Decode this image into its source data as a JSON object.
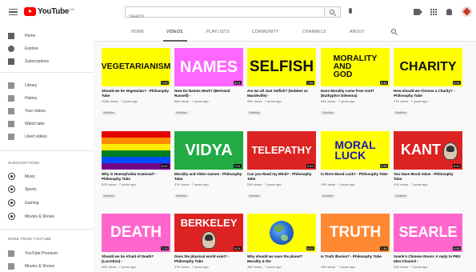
{
  "header": {
    "logo_text": "YouTube",
    "logo_sup": "CA",
    "search_placeholder": "Search"
  },
  "sidebar": {
    "primary": [
      {
        "label": "Home",
        "icon": "home-icon"
      },
      {
        "label": "Explore",
        "icon": "explore-icon"
      },
      {
        "label": "Subscriptions",
        "icon": "subscriptions-icon"
      }
    ],
    "library": [
      {
        "label": "Library",
        "icon": "library-icon"
      },
      {
        "label": "History",
        "icon": "history-icon"
      },
      {
        "label": "Your videos",
        "icon": "your-videos-icon"
      },
      {
        "label": "Watch later",
        "icon": "watch-later-icon"
      },
      {
        "label": "Liked videos",
        "icon": "liked-videos-icon"
      }
    ],
    "subscriptions_header": "SUBSCRIPTIONS",
    "subscriptions": [
      {
        "label": "Music",
        "icon": "music-icon"
      },
      {
        "label": "Sports",
        "icon": "sports-icon"
      },
      {
        "label": "Gaming",
        "icon": "gaming-icon"
      },
      {
        "label": "Movies & Shows",
        "icon": "movies-icon"
      }
    ],
    "more_header": "MORE FROM YOUTUBE",
    "more": [
      {
        "label": "YouTube Premium",
        "icon": "premium-icon"
      },
      {
        "label": "Movies & Shows",
        "icon": "movies-icon"
      }
    ]
  },
  "tabs": [
    {
      "label": "HOME"
    },
    {
      "label": "VIDEOS",
      "active": true
    },
    {
      "label": "PLAYLISTS"
    },
    {
      "label": "COMMUNITY"
    },
    {
      "label": "CHANNELS"
    },
    {
      "label": "ABOUT"
    }
  ],
  "videos": [
    {
      "thumb_text": "VEGETARIANISM",
      "bg": "#ffff00",
      "fg": "#111111",
      "duration": "7:45",
      "title": "Should we be Vegetarian? - Philosophy Tube",
      "meta": "226K views · 7 years ago",
      "badge": "Subtitles"
    },
    {
      "thumb_text": "NAMES",
      "bg": "#ff66ff",
      "fg": "#ffffff",
      "duration": "8:21",
      "title": "How Do Names Work? (Bertrand Russell) -",
      "meta": "56K views · 7 years ago",
      "badge": "Subtitles"
    },
    {
      "thumb_text": "SELFISH",
      "bg": "#ffff00",
      "fg": "#111111",
      "duration": "7:55",
      "title": "Are we all Just Selfish? (Hobbes vs Mandeville) -",
      "meta": "98K views · 7 years ago",
      "badge": "Subtitles"
    },
    {
      "thumb_text": "MORALITY\nAND\nGOD",
      "bg": "#ffff00",
      "fg": "#111111",
      "duration": "8:46",
      "title": "Does Morality come from God? (Euthyphro Dilemma)",
      "meta": "84K views · 7 years ago",
      "badge": "Subtitles"
    },
    {
      "thumb_text": "CHARITY",
      "bg": "#ffff00",
      "fg": "#111111",
      "duration": "6:34",
      "title": "How should we Choose a Charity? - Philosophy Tube",
      "meta": "27K views · 7 years ago",
      "badge": "Subtitles"
    },
    {
      "thumb_text": "",
      "bg": "rainbow",
      "fg": "#ffffff",
      "duration": "8:02",
      "title": "Why is Homophobia Irrational? - Philosophy Tube",
      "meta": "82K views · 7 years ago",
      "badge": "Subtitles"
    },
    {
      "thumb_text": "VIDYA",
      "bg": "#22aa44",
      "fg": "#ffffff",
      "duration": "9:11",
      "title": "Morality and Video Games - Philosophy Tube",
      "meta": "37K views · 7 years ago",
      "badge": "Subtitles"
    },
    {
      "thumb_text": "TELEPATHY",
      "bg": "#dd2222",
      "fg": "#ffffff",
      "duration": "6:53",
      "title": "Can you Read my Mind? - Philosophy Tube",
      "meta": "53K views · 7 years ago",
      "badge": "Subtitles"
    },
    {
      "thumb_text": "MORAL\nLUCK",
      "bg": "#ffff00",
      "fg": "#1a1aaa",
      "duration": "5:56",
      "title": "Is there Moral Luck? - Philosophy Tube",
      "meta": "19K views · 7 years ago",
      "badge": "Subtitles"
    },
    {
      "thumb_text": "KANT",
      "bg": "#dd2222",
      "fg": "#ffffff",
      "duration": "8:40",
      "title": "You Have Moral Value - Philosophy Tube",
      "meta": "41K views · 7 years ago",
      "badge": "Subtitles"
    },
    {
      "thumb_text": "DEATH",
      "bg": "#ff66cc",
      "fg": "#ffffff",
      "duration": "7:13",
      "title": "Should we be Afraid of Death? (Lucretius) -",
      "meta": "60K views · 7 years ago",
      "badge": "Subtitles"
    },
    {
      "thumb_text": "BERKELEY",
      "bg": "#dd2222",
      "fg": "#ffffff",
      "duration": "8:24",
      "title": "Does the physical world exist? - Philosophy Tube",
      "meta": "47K views · 7 years ago",
      "badge": "Subtitles"
    },
    {
      "thumb_text": "",
      "bg": "earth",
      "fg": "#ffffff",
      "duration": "6:02",
      "title": "Why should we save the planet? Morality & the",
      "meta": "35K views · 7 years ago",
      "badge": "Subtitles"
    },
    {
      "thumb_text": "TRUTH",
      "bg": "#ff8833",
      "fg": "#ffffff",
      "duration": "7:38",
      "title": "Is Truth Illusion? - Philosophy Tube",
      "meta": "48K views · 7 years ago",
      "badge": "Subtitles"
    },
    {
      "thumb_text": "SEARLE",
      "bg": "#ff66cc",
      "fg": "#ffffff",
      "duration": "9:05",
      "title": "Searle's Chinese Room: A reply to PBS Idea Channel -",
      "meta": "32K views · 7 years ago",
      "badge": "Subtitles"
    }
  ]
}
